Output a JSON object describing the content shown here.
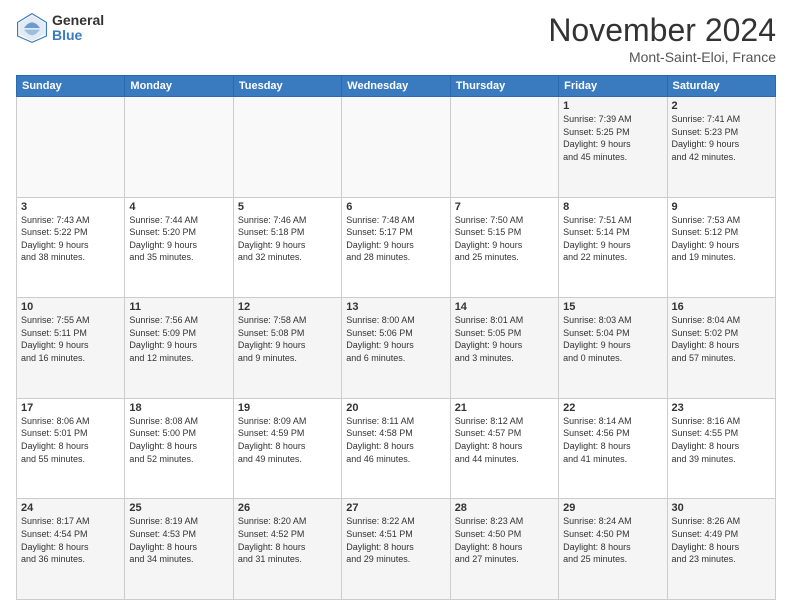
{
  "logo": {
    "general": "General",
    "blue": "Blue"
  },
  "title": "November 2024",
  "location": "Mont-Saint-Eloi, France",
  "days_header": [
    "Sunday",
    "Monday",
    "Tuesday",
    "Wednesday",
    "Thursday",
    "Friday",
    "Saturday"
  ],
  "weeks": [
    [
      {
        "day": "",
        "info": ""
      },
      {
        "day": "",
        "info": ""
      },
      {
        "day": "",
        "info": ""
      },
      {
        "day": "",
        "info": ""
      },
      {
        "day": "",
        "info": ""
      },
      {
        "day": "1",
        "info": "Sunrise: 7:39 AM\nSunset: 5:25 PM\nDaylight: 9 hours\nand 45 minutes."
      },
      {
        "day": "2",
        "info": "Sunrise: 7:41 AM\nSunset: 5:23 PM\nDaylight: 9 hours\nand 42 minutes."
      }
    ],
    [
      {
        "day": "3",
        "info": "Sunrise: 7:43 AM\nSunset: 5:22 PM\nDaylight: 9 hours\nand 38 minutes."
      },
      {
        "day": "4",
        "info": "Sunrise: 7:44 AM\nSunset: 5:20 PM\nDaylight: 9 hours\nand 35 minutes."
      },
      {
        "day": "5",
        "info": "Sunrise: 7:46 AM\nSunset: 5:18 PM\nDaylight: 9 hours\nand 32 minutes."
      },
      {
        "day": "6",
        "info": "Sunrise: 7:48 AM\nSunset: 5:17 PM\nDaylight: 9 hours\nand 28 minutes."
      },
      {
        "day": "7",
        "info": "Sunrise: 7:50 AM\nSunset: 5:15 PM\nDaylight: 9 hours\nand 25 minutes."
      },
      {
        "day": "8",
        "info": "Sunrise: 7:51 AM\nSunset: 5:14 PM\nDaylight: 9 hours\nand 22 minutes."
      },
      {
        "day": "9",
        "info": "Sunrise: 7:53 AM\nSunset: 5:12 PM\nDaylight: 9 hours\nand 19 minutes."
      }
    ],
    [
      {
        "day": "10",
        "info": "Sunrise: 7:55 AM\nSunset: 5:11 PM\nDaylight: 9 hours\nand 16 minutes."
      },
      {
        "day": "11",
        "info": "Sunrise: 7:56 AM\nSunset: 5:09 PM\nDaylight: 9 hours\nand 12 minutes."
      },
      {
        "day": "12",
        "info": "Sunrise: 7:58 AM\nSunset: 5:08 PM\nDaylight: 9 hours\nand 9 minutes."
      },
      {
        "day": "13",
        "info": "Sunrise: 8:00 AM\nSunset: 5:06 PM\nDaylight: 9 hours\nand 6 minutes."
      },
      {
        "day": "14",
        "info": "Sunrise: 8:01 AM\nSunset: 5:05 PM\nDaylight: 9 hours\nand 3 minutes."
      },
      {
        "day": "15",
        "info": "Sunrise: 8:03 AM\nSunset: 5:04 PM\nDaylight: 9 hours\nand 0 minutes."
      },
      {
        "day": "16",
        "info": "Sunrise: 8:04 AM\nSunset: 5:02 PM\nDaylight: 8 hours\nand 57 minutes."
      }
    ],
    [
      {
        "day": "17",
        "info": "Sunrise: 8:06 AM\nSunset: 5:01 PM\nDaylight: 8 hours\nand 55 minutes."
      },
      {
        "day": "18",
        "info": "Sunrise: 8:08 AM\nSunset: 5:00 PM\nDaylight: 8 hours\nand 52 minutes."
      },
      {
        "day": "19",
        "info": "Sunrise: 8:09 AM\nSunset: 4:59 PM\nDaylight: 8 hours\nand 49 minutes."
      },
      {
        "day": "20",
        "info": "Sunrise: 8:11 AM\nSunset: 4:58 PM\nDaylight: 8 hours\nand 46 minutes."
      },
      {
        "day": "21",
        "info": "Sunrise: 8:12 AM\nSunset: 4:57 PM\nDaylight: 8 hours\nand 44 minutes."
      },
      {
        "day": "22",
        "info": "Sunrise: 8:14 AM\nSunset: 4:56 PM\nDaylight: 8 hours\nand 41 minutes."
      },
      {
        "day": "23",
        "info": "Sunrise: 8:16 AM\nSunset: 4:55 PM\nDaylight: 8 hours\nand 39 minutes."
      }
    ],
    [
      {
        "day": "24",
        "info": "Sunrise: 8:17 AM\nSunset: 4:54 PM\nDaylight: 8 hours\nand 36 minutes."
      },
      {
        "day": "25",
        "info": "Sunrise: 8:19 AM\nSunset: 4:53 PM\nDaylight: 8 hours\nand 34 minutes."
      },
      {
        "day": "26",
        "info": "Sunrise: 8:20 AM\nSunset: 4:52 PM\nDaylight: 8 hours\nand 31 minutes."
      },
      {
        "day": "27",
        "info": "Sunrise: 8:22 AM\nSunset: 4:51 PM\nDaylight: 8 hours\nand 29 minutes."
      },
      {
        "day": "28",
        "info": "Sunrise: 8:23 AM\nSunset: 4:50 PM\nDaylight: 8 hours\nand 27 minutes."
      },
      {
        "day": "29",
        "info": "Sunrise: 8:24 AM\nSunset: 4:50 PM\nDaylight: 8 hours\nand 25 minutes."
      },
      {
        "day": "30",
        "info": "Sunrise: 8:26 AM\nSunset: 4:49 PM\nDaylight: 8 hours\nand 23 minutes."
      }
    ]
  ]
}
